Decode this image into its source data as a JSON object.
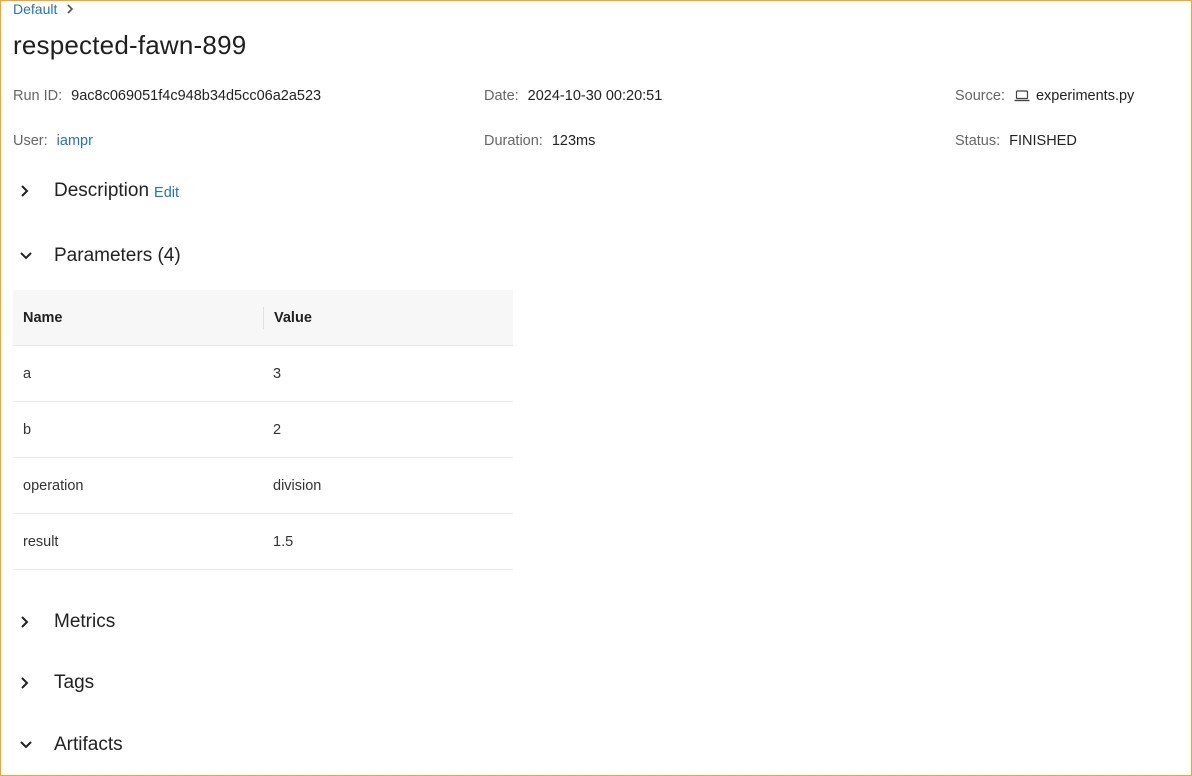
{
  "breadcrumb": {
    "parent": "Default"
  },
  "run": {
    "title": "respected-fawn-899",
    "run_id_label": "Run ID:",
    "run_id": "9ac8c069051f4c948b34d5cc06a2a523",
    "date_label": "Date:",
    "date": "2024-10-30 00:20:51",
    "source_label": "Source:",
    "source": "experiments.py",
    "user_label": "User:",
    "user": "iampr",
    "duration_label": "Duration:",
    "duration": "123ms",
    "status_label": "Status:",
    "status": "FINISHED"
  },
  "sections": {
    "description": {
      "title": "Description",
      "edit": "Edit",
      "expanded": false
    },
    "parameters": {
      "title": "Parameters (4)",
      "expanded": true
    },
    "metrics": {
      "title": "Metrics",
      "expanded": false
    },
    "tags": {
      "title": "Tags",
      "expanded": false
    },
    "artifacts": {
      "title": "Artifacts",
      "expanded": true
    }
  },
  "params_table": {
    "headers": {
      "name": "Name",
      "value": "Value"
    },
    "rows": [
      {
        "name": "a",
        "value": "3"
      },
      {
        "name": "b",
        "value": "2"
      },
      {
        "name": "operation",
        "value": "division"
      },
      {
        "name": "result",
        "value": "1.5"
      }
    ]
  },
  "colors": {
    "link": "#2374bb",
    "frame": "#f5a623"
  },
  "icons": {
    "source": "laptop-icon",
    "collapsed": "chevron-right-icon",
    "expanded": "chevron-down-icon",
    "breadcrumb_sep": "chevron-right-icon"
  }
}
